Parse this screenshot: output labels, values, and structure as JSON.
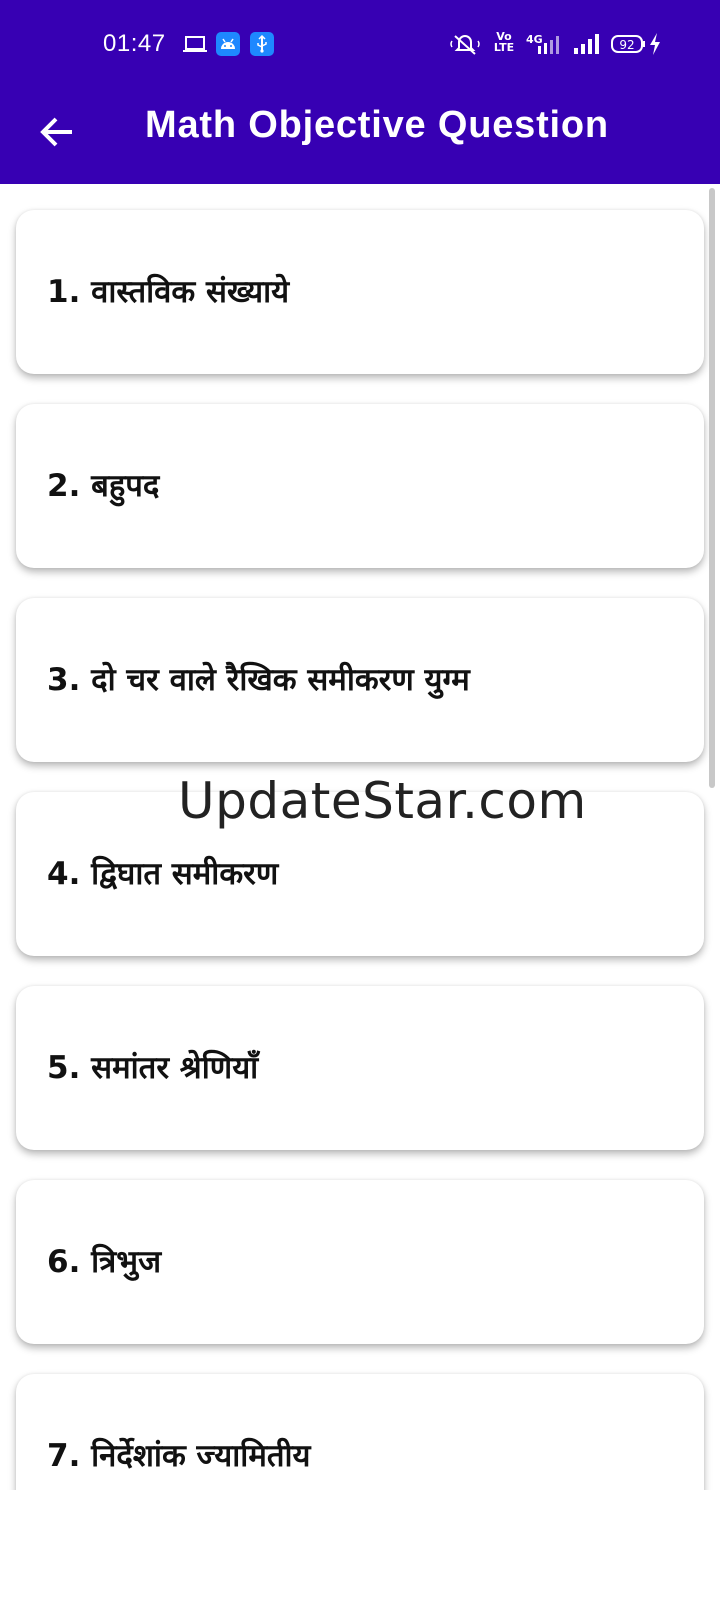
{
  "status_bar": {
    "time": "01:47",
    "battery": "92",
    "network": "4G",
    "volte": "Vo LTE",
    "icons": [
      "laptop-icon",
      "android-icon",
      "usb-icon",
      "mute-icon",
      "volte-icon",
      "signal-4g-icon",
      "signal-icon",
      "battery-icon",
      "charging-icon"
    ]
  },
  "toolbar": {
    "back_icon": "arrow-left-icon",
    "title": "Math Objective Question"
  },
  "colors": {
    "app_bar": "#3700b3",
    "background": "#ffffff",
    "card": "#ffffff",
    "text": "#111111"
  },
  "chapters": [
    {
      "label": "1. वास्तविक संख्याये"
    },
    {
      "label": "2. बहुपद"
    },
    {
      "label": "3. दो चर वाले रैखिक समीकरण युग्म"
    },
    {
      "label": "4. द्विघात समीकरण"
    },
    {
      "label": "5. समांतर श्रेणियाँ"
    },
    {
      "label": "6. त्रिभुज"
    },
    {
      "label": "7. निर्देशांक ज्यामितीय"
    }
  ],
  "watermark": "UpdateStar.com"
}
